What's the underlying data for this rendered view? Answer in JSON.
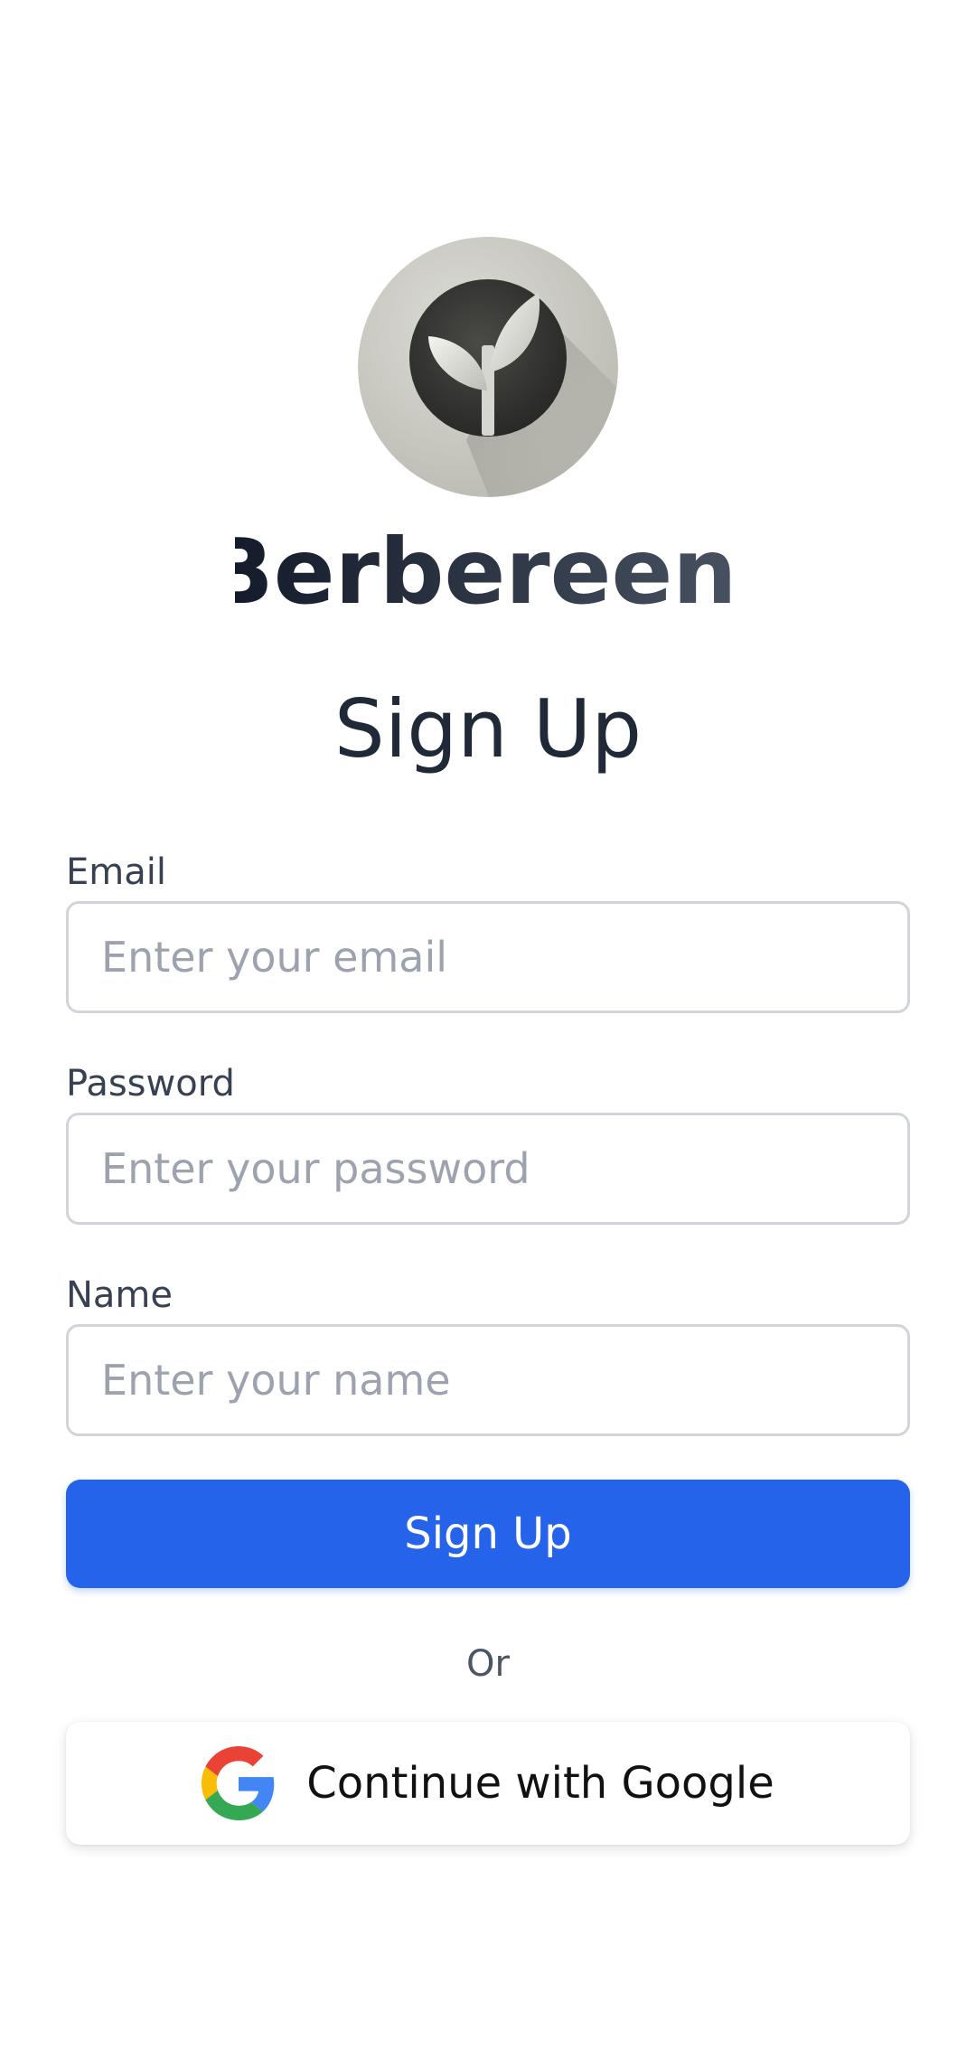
{
  "brand": {
    "name": "Berbereen.",
    "logo_icon": "sprout-icon"
  },
  "title": "Sign Up",
  "form": {
    "email": {
      "label": "Email",
      "placeholder": "Enter your email",
      "value": ""
    },
    "password": {
      "label": "Password",
      "placeholder": "Enter your password",
      "value": ""
    },
    "name": {
      "label": "Name",
      "placeholder": "Enter your name",
      "value": ""
    }
  },
  "signup_button": "Sign Up",
  "divider": "Or",
  "google_button": {
    "label": "Continue with Google",
    "icon": "google-icon"
  },
  "colors": {
    "primary": "#2563eb",
    "text": "#1f2937",
    "muted": "#9ca3af",
    "border": "#d1d5db"
  }
}
